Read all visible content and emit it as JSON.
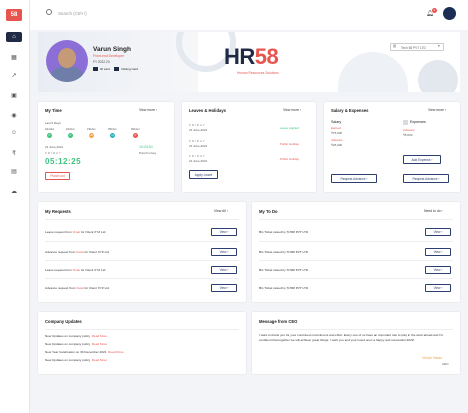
{
  "app": {
    "logo_text": "58"
  },
  "search": {
    "placeholder": "Search (Ctrl+/)"
  },
  "topbar": {
    "notification_count": "4"
  },
  "hero": {
    "name": "Varun Singh",
    "designation": "Front-end Developer",
    "fy": "FY 2022-23",
    "id_label": "ID card",
    "visiting_label": "Visiting Card",
    "brand_main": "HR",
    "brand_num": "58",
    "brand_sub": "Human Resources Solutions",
    "week_label": "Tech 58 PVT LTD"
  },
  "my_time": {
    "title": "My Time",
    "view_more": "View more",
    "subtitle": "Last 5 Days",
    "days": [
      {
        "label": "22ndJun",
        "status": "P",
        "color": "#3ec37d"
      },
      {
        "label": "23rdJun",
        "status": "P",
        "color": "#3ec37d"
      },
      {
        "label": "24thJun",
        "status": "HD",
        "color": "#f0a13a"
      },
      {
        "label": "25thJun",
        "status": "H",
        "color": "#2bb3c0"
      },
      {
        "label": "26thJun",
        "status": "P",
        "color": "#e8554e"
      }
    ],
    "date": "21 June,2021",
    "day": "FRIDAY",
    "timer": "05:12:25",
    "punch_time": "10:24:51",
    "punch_label": "Punch in key",
    "punch_out": "Punch out"
  },
  "leaves": {
    "title": "Leaves & Holidays",
    "view_more": "View more",
    "items": [
      {
        "day": "FRIDAY",
        "date": "21 June,2021",
        "status": "Leave Applied",
        "color": "#3ec37d"
      },
      {
        "day": "FRIDAY",
        "date": "21 June,2021",
        "status": "Public Holiday",
        "color": "#e8554e"
      },
      {
        "day": "FRIDAY",
        "date": "21 June,2021",
        "status": "Public Holiday",
        "color": "#e8554e"
      }
    ],
    "apply": "Apply Leave"
  },
  "salary": {
    "title": "Salary & Expenses",
    "view_more": "View more",
    "salary_label": "Salary",
    "earned_label": "Earned",
    "earned_value": "₹75,000",
    "advance_label": "Advance",
    "advance_value": "₹25,000",
    "expense_label": "Expenses",
    "exp_advance_label": "Advance",
    "exp_advance_value": "₹5,000",
    "add_expense": "Add Expense",
    "request_advance": "Request Advance",
    "request_advance2": "Request Advance"
  },
  "requests": {
    "title": "My Requests",
    "view_all": "View All",
    "rows": [
      {
        "pre": "Leave request from ",
        "hl": "Vivek",
        "post": " for Client XYZ Ltd",
        "btn": "View"
      },
      {
        "pre": "Advance request from ",
        "hl": "Vivek",
        "post": " for Client XYZ Ltd",
        "btn": "View"
      },
      {
        "pre": "Leave request from ",
        "hl": "Vivek",
        "post": " for Client XYZ Ltd",
        "btn": "View"
      },
      {
        "pre": "Advance request from ",
        "hl": "Vivek",
        "post": " for Client XYZ Ltd",
        "btn": "View"
      }
    ]
  },
  "todo": {
    "title": "My To Do",
    "need_todo": "Need to do",
    "rows": [
      {
        "text": "BG Ticket raised by Tch58 PVT LTD",
        "btn": "View"
      },
      {
        "text": "BG Ticket raised by Tch58 PVT LTD",
        "btn": "View"
      },
      {
        "text": "BG Ticket raised by Tch58 PVT LTD",
        "btn": "View"
      },
      {
        "text": "BG Ticket raised by Tch58 PVT LTD",
        "btn": "View"
      }
    ]
  },
  "updates": {
    "title": "Company Updates",
    "rows": [
      {
        "text": "New Updates on company policy",
        "link": "Read More"
      },
      {
        "text": "New Updates on company policy",
        "link": "Read More"
      },
      {
        "text": "New Year Celebration on 30 December 2021",
        "link": "Read More"
      },
      {
        "text": "New Updates on company policy",
        "link": "Read More"
      }
    ]
  },
  "ceo": {
    "title": "Message from CEO",
    "message": "I want to thank you for your continued commitment and effort. Every one of us have an important role to play in the work ahead and I'm confident that together we will achieve great things. I wish you and your loved ones a happy and successful 2022!",
    "sign_name": "Vishal Yadav",
    "sign_role": "CEO"
  }
}
